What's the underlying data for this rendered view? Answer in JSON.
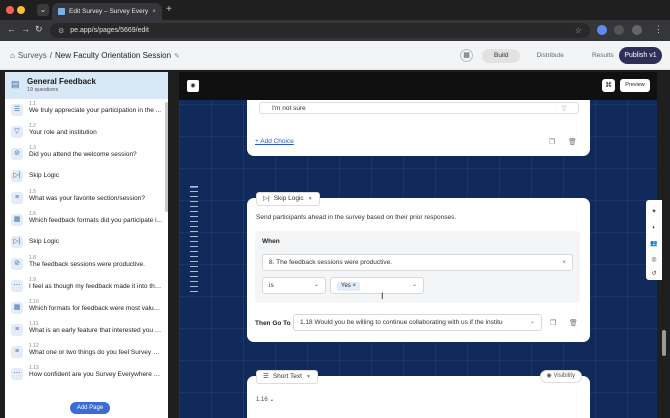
{
  "browser": {
    "tab_title": "Edit Survey – Survey Everywh",
    "url": "pe.app/s/pages/5669/edit"
  },
  "header": {
    "root": "Surveys",
    "separator": "/",
    "title": "New Faculty Orientation Session",
    "tabs": [
      "Build",
      "Distribute",
      "Results"
    ],
    "active_tab": "Build",
    "publish_label": "Publish v1"
  },
  "sidebar": {
    "title": "General Feedback",
    "subtitle": "19 questions",
    "items": [
      {
        "num": "1.1",
        "label": "We truly appreciate your participation in the ...",
        "icon": "list-icon"
      },
      {
        "num": "1.2",
        "label": "Your role and institution",
        "icon": "filter-icon"
      },
      {
        "num": "1.3",
        "label": "Did you attend the welcome session?",
        "icon": "check-circle-icon"
      },
      {
        "num": "",
        "label": "Skip Logic",
        "icon": "skip-logic-icon"
      },
      {
        "num": "1.5",
        "label": "What was your favorite section/session?",
        "icon": "text-icon"
      },
      {
        "num": "1.6",
        "label": "Which feedback formats did you participate i...",
        "icon": "grid-icon"
      },
      {
        "num": "",
        "label": "Skip Logic",
        "icon": "skip-logic-icon"
      },
      {
        "num": "1.8",
        "label": "The feedback sessions were productive.",
        "icon": "check-circle-icon"
      },
      {
        "num": "1.9",
        "label": "I feel as though my feedback made it into the ...",
        "icon": "scale-icon"
      },
      {
        "num": "1.10",
        "label": "Which formats for feedback were most valua...",
        "icon": "grid-icon"
      },
      {
        "num": "1.11",
        "label": "What is an early feature that interested you a...",
        "icon": "text-icon"
      },
      {
        "num": "1.12",
        "label": "What one or two things do you feel Survey Ev...",
        "icon": "text-icon"
      },
      {
        "num": "1.13",
        "label": "How confident are you Survey Everywhere m...",
        "icon": "scale-icon"
      }
    ],
    "add_page": "Add Page"
  },
  "canvas": {
    "preview": "Preview",
    "choice_text": "I'm not sure",
    "add_choice": "+ Add Choice",
    "skip_logic": {
      "tag": "Skip Logic",
      "description": "Send participants ahead in the survey based on their prior responses.",
      "when_label": "When",
      "question": "8. The feedback sessions were productive.",
      "operator": "is",
      "value": "Yes",
      "goto_label": "Then Go To",
      "goto_target": "1.18 Would you be willing to continue collaborating with us if the institu"
    },
    "next_card": {
      "tag": "Short Text",
      "visibility": "Visibility",
      "number": "1.16"
    }
  }
}
